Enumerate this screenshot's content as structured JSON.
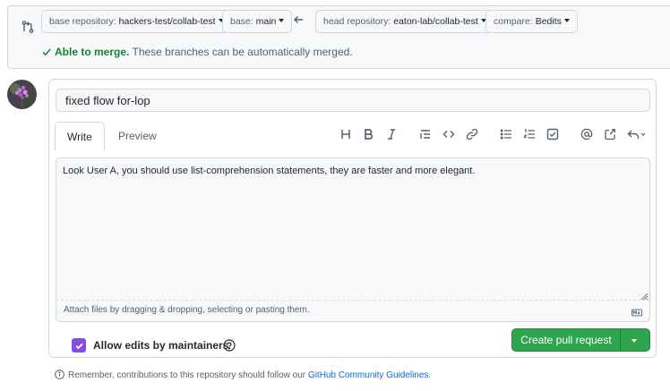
{
  "compare": {
    "base_repo_key": "base repository:",
    "base_repo_val": "hackers-test/collab-test",
    "base_key": "base:",
    "base_val": "main",
    "head_repo_key": "head repository:",
    "head_repo_val": "eaton-lab/collab-test",
    "compare_key": "compare:",
    "compare_val": "Bedits",
    "merge_ok": "Able to merge.",
    "merge_msg": "These branches can be automatically merged."
  },
  "form": {
    "title_value": "fixed flow for-lop",
    "tabs": [
      "Write",
      "Preview"
    ],
    "body_text": "Look User A, you should use list-comprehension statements, they are faster and more elegant.",
    "attach_hint": "Attach files by dragging & dropping, selecting or pasting them.",
    "allow_edits_label": "Allow edits by maintainers",
    "allow_edits_checked": true,
    "create_button": "Create pull request"
  },
  "toolbar": [
    "heading-icon",
    "bold-icon",
    "italic-icon",
    "quote-icon",
    "code-icon",
    "link-icon",
    "bulleted-list-icon",
    "numbered-list-icon",
    "task-list-icon",
    "mention-icon",
    "cross-reference-icon",
    "reply-icon"
  ],
  "footer": {
    "reminder_text": "Remember, contributions to this repository should follow our",
    "guidelines_link": "GitHub Community Guidelines",
    "period": "."
  },
  "colors": {
    "accent_green": "#2da44e",
    "checkbox_purple": "#8250df",
    "link_blue": "#0969da"
  }
}
